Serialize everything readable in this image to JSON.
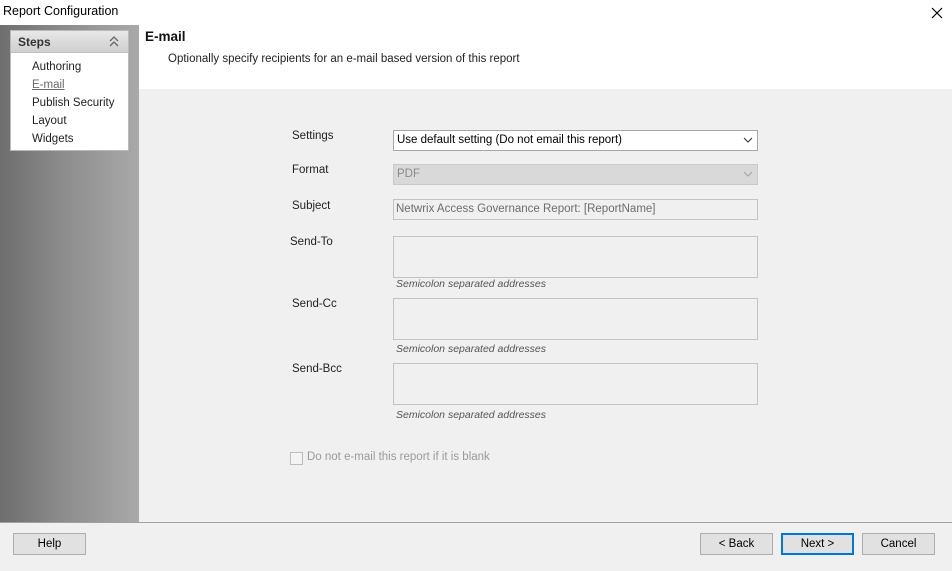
{
  "window": {
    "title": "Report Configuration"
  },
  "steps": {
    "header": "Steps",
    "items": [
      {
        "label": "Authoring"
      },
      {
        "label": "E-mail"
      },
      {
        "label": "Publish Security"
      },
      {
        "label": "Layout"
      },
      {
        "label": "Widgets"
      }
    ],
    "active": "E-mail"
  },
  "header": {
    "title": "E-mail",
    "subtitle": "Optionally specify recipients for an e-mail based version of this report"
  },
  "form": {
    "settings": {
      "label": "Settings",
      "value": "Use default setting (Do not email this report)"
    },
    "format": {
      "label": "Format",
      "value": "PDF"
    },
    "subject": {
      "label": "Subject",
      "value": "Netwrix Access Governance Report: [ReportName]"
    },
    "send_to": {
      "label": "Send-To",
      "value": "",
      "hint": "Semicolon separated addresses"
    },
    "send_cc": {
      "label": "Send-Cc",
      "value": "",
      "hint": "Semicolon separated addresses"
    },
    "send_bcc": {
      "label": "Send-Bcc",
      "value": "",
      "hint": "Semicolon separated addresses"
    },
    "blank_checkbox": {
      "label": "Do not e-mail this report if it is blank",
      "checked": false
    }
  },
  "footer": {
    "help": "Help",
    "back": "< Back",
    "next": "Next >",
    "cancel": "Cancel"
  },
  "icons": {
    "close": "close-icon",
    "collapse": "double-chevron-up-icon",
    "dropdown": "chevron-down-icon"
  }
}
